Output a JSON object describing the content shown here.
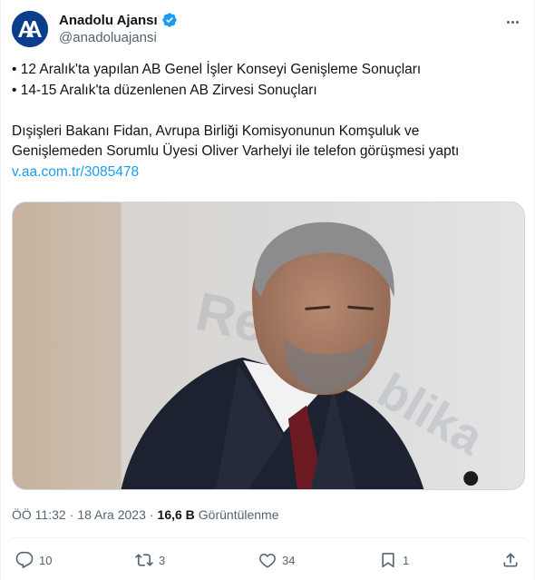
{
  "author": {
    "display_name": "Anadolu Ajansı",
    "handle": "@anadoluajansi",
    "verified": true,
    "avatar_icon": "aa-logo-icon"
  },
  "tweet": {
    "lines": [
      "• 12 Aralık'ta yapılan AB Genel İşler Konseyi Genişleme Sonuçları",
      "• 14-15 Aralık'ta düzenlenen AB Zirvesi Sonuçları",
      "",
      "Dışişleri Bakanı Fidan, Avrupa Birliği Komisyonunun Komşuluk ve",
      "Genişlemeden Sorumlu Üyesi Oliver Varhelyi ile telefon görüşmesi yaptı"
    ],
    "link": "v.aa.com.tr/3085478",
    "link_color": "#1d9bf0"
  },
  "meta": {
    "time": "ÖÖ 11:32",
    "separator": "·",
    "date": "18 Ara 2023",
    "views_count": "16,6 B",
    "views_label": "Görüntülenme"
  },
  "actions": {
    "replies": "10",
    "reposts": "3",
    "likes": "34",
    "bookmarks": "1"
  },
  "colors": {
    "secondary_text": "#536471",
    "verified_badge": "#1d9bf0",
    "avatar_bg": "#0a3d8c"
  }
}
